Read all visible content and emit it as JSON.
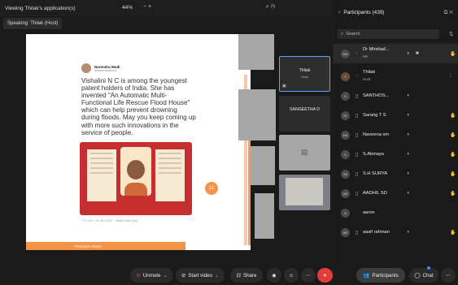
{
  "topbar": {
    "title": "Viewing Thilak's application(s)",
    "zoom": "44%",
    "zoom_controls": "−  +",
    "right_icons": "⌕  ◷"
  },
  "speaking": "Speaking: Thilak (Host)",
  "slide": {
    "tweet_author": "Narendra Modi",
    "tweet_handle": "@narendramodi",
    "tweet_body": "Vishalini N C is among the youngest patent holders of India. She has invented \"An Automatic Multi-Functional Life Rescue Flood House\" which can help prevent drowning during floods. May you keep coming up with more such innovations in the service of people.",
    "tweet_meta": "7:37 pm · 24 Jan 2020 · Twitter Web App",
    "footer_text": "Presenter Notes",
    "fab_label": "11"
  },
  "thumbnails": [
    {
      "name": "Thilak",
      "sub": "Host",
      "active": true
    },
    {
      "name": "SANGEETHA D",
      "sub": "",
      "active": false
    }
  ],
  "panel": {
    "title": "Participants (439)",
    "header_icons": "⧉  ✕",
    "search_placeholder": "Search",
    "participants": [
      {
        "initials": "DM",
        "name": "Dr Mirshad...",
        "sub": "Me",
        "hand": true
      },
      {
        "initials": "T",
        "name": "Thilak",
        "sub": "Host",
        "signal": true
      },
      {
        "initials": "S",
        "name": "SANTHOS...",
        "sub": ""
      },
      {
        "initials": "ST",
        "name": "Sarang T S",
        "sub": "",
        "hand": true
      },
      {
        "initials": "NS",
        "name": "Naveena sm",
        "sub": "",
        "hand": true
      },
      {
        "initials": "S",
        "name": "S.Abinaya",
        "sub": "",
        "hand": true
      },
      {
        "initials": "SS",
        "name": "S.H SURYA",
        "sub": "",
        "hand": true
      },
      {
        "initials": "AS",
        "name": "AADHIL SD",
        "sub": "",
        "hand": true
      },
      {
        "initials": "A",
        "name": "aaron",
        "sub": ""
      },
      {
        "initials": "AR",
        "name": "aasif rahman",
        "sub": "",
        "hand": true
      }
    ]
  },
  "controls": {
    "unmute": "Unmute",
    "start_video": "Start video",
    "share": "Share",
    "participants": "Participants",
    "chat": "Chat"
  },
  "colors": {
    "accent": "#5aa6ff",
    "slide_orange": "#f59446",
    "card_red": "#c62f2f",
    "leave_red": "#e23b3b",
    "hand_pink": "#e33b6e"
  }
}
